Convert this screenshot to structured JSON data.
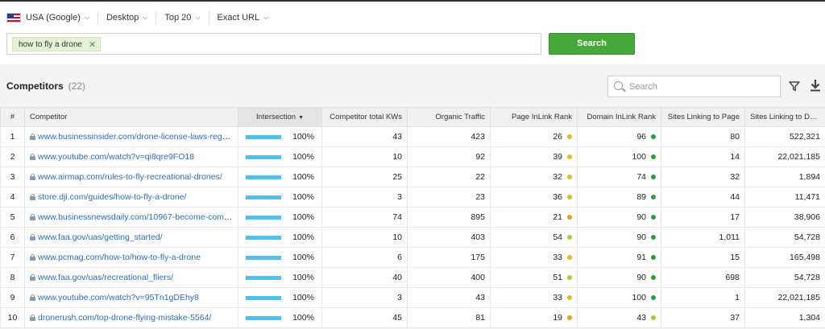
{
  "filters": {
    "country": "USA (Google)",
    "device": "Desktop",
    "top": "Top 20",
    "match": "Exact URL"
  },
  "search": {
    "keyword_tag": "how to fly a drone",
    "button_label": "Search"
  },
  "competitors": {
    "title": "Competitors",
    "count": "(22)",
    "search_placeholder": "Search"
  },
  "columns": [
    "#",
    "Competitor",
    "Intersection",
    "Competitor total KWs",
    "Organic Traffic",
    "Page InLink Rank",
    "Domain InLink Rank",
    "Sites Linking to Page",
    "Sites Linking to Do..."
  ],
  "colors": {
    "search_button": "#46a83a",
    "intersection_bar": "#4fc1ea",
    "link": "#2f6cb5",
    "rank_dot_green": "#2e9e3a",
    "rank_dot_lime": "#a3cf3a",
    "rank_dot_yellow": "#d9c020",
    "rank_dot_orange": "#e0a020"
  },
  "rows": [
    {
      "n": "1",
      "url": "www.businessinsider.com/drone-license-laws-regul...",
      "intersection": "100%",
      "total_kws": "43",
      "traffic": "423",
      "page_rank": "26",
      "page_dot": "yellow",
      "domain_rank": "96",
      "domain_dot": "green",
      "sites_page": "80",
      "sites_domain": "522,321"
    },
    {
      "n": "2",
      "url": "www.youtube.com/watch?v=qi8qre9FO18",
      "intersection": "100%",
      "total_kws": "10",
      "traffic": "92",
      "page_rank": "39",
      "page_dot": "yellow",
      "domain_rank": "100",
      "domain_dot": "green",
      "sites_page": "14",
      "sites_domain": "22,021,185"
    },
    {
      "n": "3",
      "url": "www.airmap.com/rules-to-fly-recreational-drones/",
      "intersection": "100%",
      "total_kws": "25",
      "traffic": "22",
      "page_rank": "32",
      "page_dot": "yellow",
      "domain_rank": "74",
      "domain_dot": "green",
      "sites_page": "32",
      "sites_domain": "1,894"
    },
    {
      "n": "4",
      "url": "store.dji.com/guides/how-to-fly-a-drone/",
      "intersection": "100%",
      "total_kws": "3",
      "traffic": "23",
      "page_rank": "36",
      "page_dot": "yellow",
      "domain_rank": "89",
      "domain_dot": "green",
      "sites_page": "44",
      "sites_domain": "11,471"
    },
    {
      "n": "5",
      "url": "www.businessnewsdaily.com/10967-become-comm...",
      "intersection": "100%",
      "total_kws": "74",
      "traffic": "895",
      "page_rank": "21",
      "page_dot": "orange",
      "domain_rank": "90",
      "domain_dot": "green",
      "sites_page": "17",
      "sites_domain": "38,906"
    },
    {
      "n": "6",
      "url": "www.faa.gov/uas/getting_started/",
      "intersection": "100%",
      "total_kws": "10",
      "traffic": "403",
      "page_rank": "54",
      "page_dot": "lime",
      "domain_rank": "90",
      "domain_dot": "green",
      "sites_page": "1,011",
      "sites_domain": "54,728"
    },
    {
      "n": "7",
      "url": "www.pcmag.com/how-to/how-to-fly-a-drone",
      "intersection": "100%",
      "total_kws": "6",
      "traffic": "175",
      "page_rank": "33",
      "page_dot": "yellow",
      "domain_rank": "91",
      "domain_dot": "green",
      "sites_page": "15",
      "sites_domain": "165,498"
    },
    {
      "n": "8",
      "url": "www.faa.gov/uas/recreational_fliers/",
      "intersection": "100%",
      "total_kws": "40",
      "traffic": "400",
      "page_rank": "51",
      "page_dot": "lime",
      "domain_rank": "90",
      "domain_dot": "green",
      "sites_page": "698",
      "sites_domain": "54,728"
    },
    {
      "n": "9",
      "url": "www.youtube.com/watch?v=95Tn1gDEhy8",
      "intersection": "100%",
      "total_kws": "3",
      "traffic": "43",
      "page_rank": "33",
      "page_dot": "yellow",
      "domain_rank": "100",
      "domain_dot": "green",
      "sites_page": "1",
      "sites_domain": "22,021,185"
    },
    {
      "n": "10",
      "url": "dronerush.com/top-drone-flying-mistake-5564/",
      "intersection": "100%",
      "total_kws": "45",
      "traffic": "81",
      "page_rank": "19",
      "page_dot": "orange",
      "domain_rank": "43",
      "domain_dot": "lime",
      "sites_page": "37",
      "sites_domain": "1,304"
    }
  ]
}
